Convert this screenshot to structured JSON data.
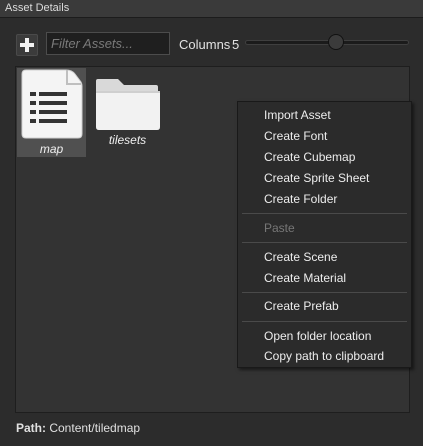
{
  "window": {
    "title": "Asset Details"
  },
  "toolbar": {
    "filter_placeholder": "Filter Assets...",
    "columns_label": "Columns",
    "columns_value": "5"
  },
  "assets": [
    {
      "name": "map",
      "icon": "document-icon",
      "selected": true
    },
    {
      "name": "tilesets",
      "icon": "folder-icon",
      "selected": false
    }
  ],
  "context_menu": {
    "groups": [
      [
        {
          "label": "Import Asset",
          "enabled": true
        },
        {
          "label": "Create Font",
          "enabled": true
        },
        {
          "label": "Create Cubemap",
          "enabled": true
        },
        {
          "label": "Create Sprite Sheet",
          "enabled": true
        },
        {
          "label": "Create Folder",
          "enabled": true
        }
      ],
      [
        {
          "label": "Paste",
          "enabled": false
        }
      ],
      [
        {
          "label": "Create Scene",
          "enabled": true
        },
        {
          "label": "Create Material",
          "enabled": true
        }
      ],
      [
        {
          "label": "Create Prefab",
          "enabled": true
        }
      ],
      [
        {
          "label": "Open folder location",
          "enabled": true
        },
        {
          "label": "Copy path to clipboard",
          "enabled": true
        }
      ]
    ]
  },
  "footer": {
    "path_label": "Path:",
    "path_value": "Content/tiledmap"
  }
}
